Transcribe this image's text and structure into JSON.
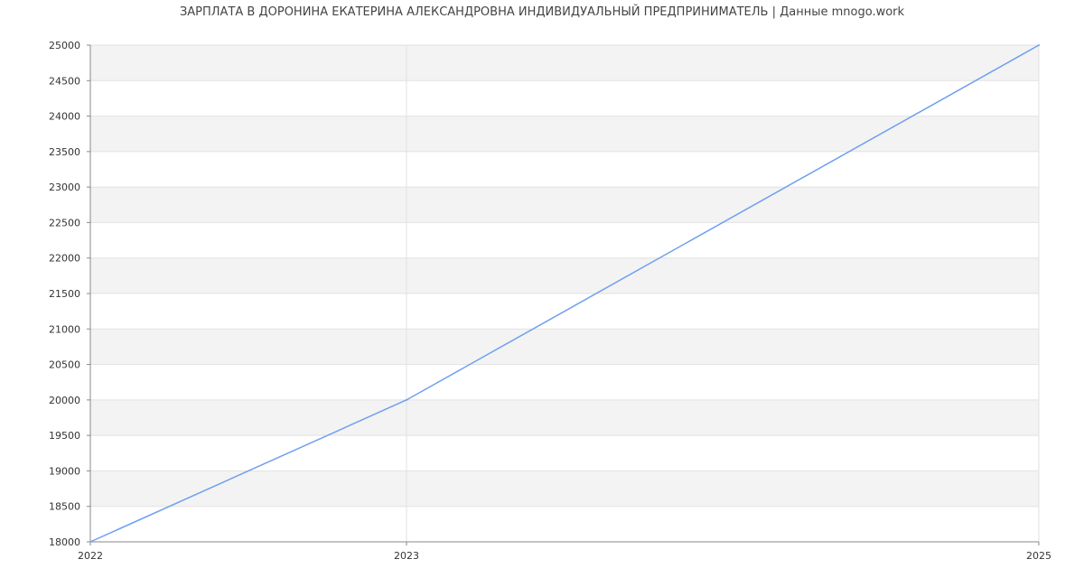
{
  "chart_data": {
    "type": "line",
    "title": "ЗАРПЛАТА В ДОРОНИНА ЕКАТЕРИНА АЛЕКСАНДРОВНА ИНДИВИДУАЛЬНЫЙ ПРЕДПРИНИМАТЕЛЬ | Данные mnogo.work",
    "xlabel": "",
    "ylabel": "",
    "x": [
      2022,
      2023,
      2025
    ],
    "x_tick_labels": [
      "2022",
      "2023",
      "2025"
    ],
    "series": [
      {
        "values": [
          18000,
          20000,
          25000
        ]
      }
    ],
    "ylim": [
      18000,
      25000
    ],
    "y_ticks": [
      18000,
      18500,
      19000,
      19500,
      20000,
      20500,
      21000,
      21500,
      22000,
      22500,
      23000,
      23500,
      24000,
      24500,
      25000
    ],
    "grid": true,
    "legend": "none",
    "colors": {
      "line": "#6f9ff0",
      "band": "#f3f3f3",
      "grid": "#e2e2e2",
      "axis": "#888888",
      "tick_text": "#333333"
    }
  }
}
